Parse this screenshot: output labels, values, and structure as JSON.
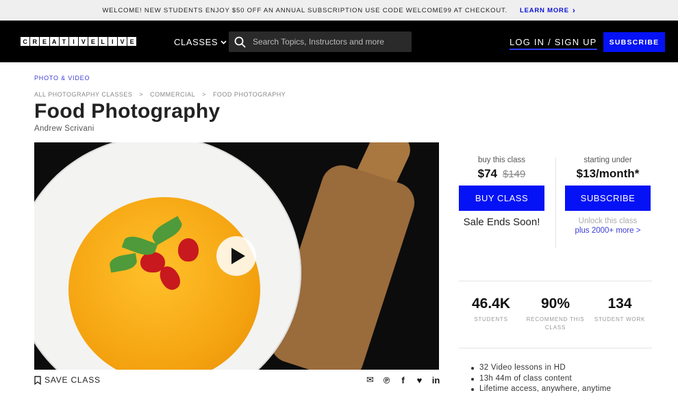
{
  "promo": {
    "text": "WELCOME! NEW STUDENTS ENJOY $50 OFF AN ANNUAL SUBSCRIPTION USE CODE WELCOME99 AT CHECKOUT.",
    "link": "LEARN MORE"
  },
  "header": {
    "logo_letters": [
      "C",
      "R",
      "E",
      "A",
      "T",
      "I",
      "V",
      "E",
      "L",
      "I",
      "V",
      "E"
    ],
    "classes": "CLASSES",
    "search_placeholder": "Search Topics, Instructors and more",
    "login": "LOG IN / SIGN UP",
    "subscribe": "SUBSCRIBE"
  },
  "page": {
    "category": "PHOTO & VIDEO",
    "breadcrumb": [
      "ALL PHOTOGRAPHY CLASSES",
      ">",
      "COMMERCIAL",
      ">",
      "FOOD PHOTOGRAPHY"
    ],
    "title": "Food Photography",
    "author": "Andrew Scrivani",
    "save_class": "SAVE CLASS"
  },
  "purchase": {
    "buy_label": "buy this class",
    "price": "$74",
    "old_price": "$149",
    "buy_button": "BUY CLASS",
    "sale": "Sale Ends Soon!",
    "sub_label": "starting under",
    "sub_price": "$13/month*",
    "sub_button": "SUBSCRIBE",
    "unlock": "Unlock this class",
    "more": "plus 2000+ more >"
  },
  "stats": [
    {
      "num": "46.4K",
      "label": "STUDENTS"
    },
    {
      "num": "90%",
      "label": "RECOMMEND THIS CLASS"
    },
    {
      "num": "134",
      "label": "STUDENT WORK"
    }
  ],
  "features": [
    "32 Video lessons in HD",
    "13h 44m of class content",
    "Lifetime access, anywhere, anytime"
  ],
  "colors": {
    "accent": "#0512f5",
    "link": "#3b3bd6"
  }
}
